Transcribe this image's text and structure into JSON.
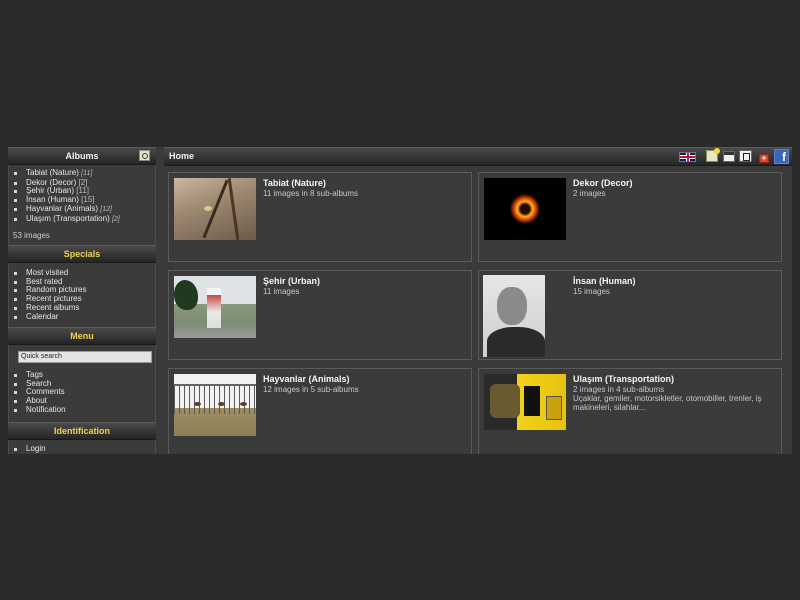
{
  "albums_panel": {
    "title": "Albums",
    "items": [
      {
        "label": "Tabiat (Nature)",
        "count": "[11]",
        "italic": true
      },
      {
        "label": "Dekor (Decor)",
        "count": "[2]",
        "italic": false
      },
      {
        "label": "Şehir (Urban)",
        "count": "[11]",
        "italic": false
      },
      {
        "label": "İnsan (Human)",
        "count": "[15]",
        "italic": false
      },
      {
        "label": "Hayvanlar (Animals)",
        "count": "[12]",
        "italic": true
      },
      {
        "label": "Ulaşım (Transportation)",
        "count": "[2]",
        "italic": true
      }
    ],
    "total": "53 images"
  },
  "specials_panel": {
    "title": "Specials",
    "items": [
      "Most visited",
      "Best rated",
      "Random pictures",
      "Recent pictures",
      "Recent albums",
      "Calendar"
    ]
  },
  "menu_panel": {
    "title": "Menu",
    "quick_search_placeholder": "Quick search",
    "items": [
      "Tags",
      "Search",
      "Comments",
      "About",
      "Notification"
    ]
  },
  "identification_panel": {
    "title": "Identification",
    "items": [
      "Login"
    ]
  },
  "breadcrumb": "Home",
  "toolbar_icons": [
    "uk-flag-icon",
    "note-icon",
    "calendar-icon",
    "sort-icon",
    "add-icon",
    "facebook-icon"
  ],
  "facebook_glyph": "f",
  "add_glyph": "+",
  "albums": [
    {
      "title": "Tabiat (Nature)",
      "info": "11 images in 8 sub-albums",
      "desc": ""
    },
    {
      "title": "Dekor (Decor)",
      "info": "2 images",
      "desc": ""
    },
    {
      "title": "Şehir (Urban)",
      "info": "11 images",
      "desc": ""
    },
    {
      "title": "İnsan (Human)",
      "info": "15 images",
      "desc": ""
    },
    {
      "title": "Hayvanlar (Animals)",
      "info": "12 images in 5 sub-albums",
      "desc": ""
    },
    {
      "title": "Ulaşım (Transportation)",
      "info": "2 images in 4 sub-albums",
      "desc": "Uçaklar, gemiler, motorsikletler, otomobiller, trenler, iş makineleri, silahlar..."
    }
  ],
  "colors": {
    "page_bg": "#2a2a2a",
    "panel_bg": "#3b3b3b",
    "accent_title": "#f2d24b",
    "facebook": "#3b66b5"
  }
}
